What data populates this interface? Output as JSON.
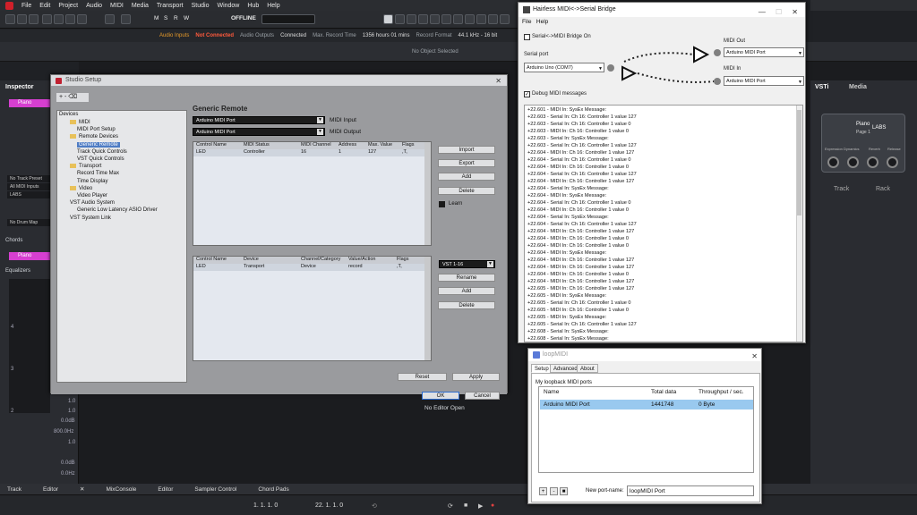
{
  "menubar": {
    "items": [
      "File",
      "Edit",
      "Project",
      "Audio",
      "MIDI",
      "Media",
      "Transport",
      "Studio",
      "Window",
      "Hub",
      "Help"
    ]
  },
  "toolbar": {
    "offline_label": "OFFLINE",
    "msrw": [
      "M",
      "S",
      "R",
      "W"
    ]
  },
  "status": {
    "audio_inputs": "Audio Inputs",
    "not_connected": "Not Connected",
    "audio_outputs": "Audio Outputs",
    "connected": "Connected",
    "max_rec_label": "Max. Record Time",
    "max_rec_value": "1356 hours 01 mins",
    "rec_format_label": "Record Format",
    "rec_format_value": "44.1 kHz - 16 bit"
  },
  "infoline": {
    "no_object": "No Object Selected"
  },
  "inspector": {
    "tab": "Inspector",
    "track_name": "Piano",
    "routing": [
      "No Track Preset",
      "All MIDI Inputs",
      "LABS",
      "No Drum Map"
    ],
    "chords_label": "Chords",
    "chords_track": "Piano",
    "equalizers_label": "Equalizers",
    "meter_nums": [
      "4",
      "3",
      "2"
    ],
    "values": [
      "1.0",
      "1.0",
      "0.0dB",
      "800.0Hz",
      "1.0",
      "0.0dB",
      "0.0Hz"
    ]
  },
  "editor": {
    "no_editor": "No Editor Open"
  },
  "bottom_tabs": [
    "Track",
    "Editor",
    "MixConsole",
    "Editor",
    "Sampler Control",
    "Chord Pads"
  ],
  "transport": {
    "left_locator": "1. 1. 1. 0",
    "right_locator": "22. 1. 1. 0",
    "position": "0:00:00.000",
    "tempo": "4/4"
  },
  "rack": {
    "tabs": [
      "VSTi",
      "Media"
    ],
    "slot_name": "Piano",
    "slot_plugin": "LABS",
    "slot_page": "Page 1",
    "knob_labels": [
      "Expression",
      "Dynamics",
      "Reverb",
      "Release"
    ],
    "track_label": "Track",
    "rack_label": "Rack"
  },
  "studio_setup": {
    "title": "Studio Setup",
    "tree_toolbar": "+ - ⌫",
    "devices_label": "Devices",
    "tree": [
      {
        "label": "MIDI",
        "indent": 1,
        "folder": true
      },
      {
        "label": "MIDI Port Setup",
        "indent": 2,
        "folder": false
      },
      {
        "label": "Remote Devices",
        "indent": 1,
        "folder": true
      },
      {
        "label": "Generic Remote",
        "indent": 2,
        "folder": false,
        "selected": true
      },
      {
        "label": "Track Quick Controls",
        "indent": 2,
        "folder": false
      },
      {
        "label": "VST Quick Controls",
        "indent": 2,
        "folder": false
      },
      {
        "label": "Transport",
        "indent": 1,
        "folder": true
      },
      {
        "label": "Record Time Max",
        "indent": 2,
        "folder": false
      },
      {
        "label": "Time Display",
        "indent": 2,
        "folder": false
      },
      {
        "label": "Video",
        "indent": 1,
        "folder": true
      },
      {
        "label": "Video Player",
        "indent": 2,
        "folder": false
      },
      {
        "label": "VST Audio System",
        "indent": 1,
        "folder": false
      },
      {
        "label": "Generic Low Latency ASIO Driver",
        "indent": 2,
        "folder": false
      },
      {
        "label": "VST System Link",
        "indent": 1,
        "folder": false
      }
    ],
    "heading": "Generic Remote",
    "midi_input_value": "Arduino MIDI Port",
    "midi_input_label": "MIDI Input",
    "midi_output_value": "Arduino MIDI Port",
    "midi_output_label": "MIDI Output",
    "table1": {
      "headers": [
        "Control Name",
        "MIDI Status",
        "MIDI Channel",
        "Address",
        "Max. Value",
        "Flags"
      ],
      "row": [
        "LED",
        "Controller",
        "16",
        "1",
        "127",
        ",T,"
      ]
    },
    "table2": {
      "headers": [
        "Control Name",
        "Device",
        "Channel/Category",
        "Value/Action",
        "Flags"
      ],
      "row": [
        "LED",
        "Transport",
        "Device",
        "record",
        ",T,"
      ]
    },
    "buttons_top": [
      "Import",
      "Export",
      "Add",
      "Delete"
    ],
    "learn": "Learn",
    "vst_combo": "VST 1-16",
    "buttons_bottom": [
      "Rename",
      "Add",
      "Delete"
    ],
    "reset": "Reset",
    "apply": "Apply",
    "ok": "OK",
    "cancel": "Cancel"
  },
  "hairless": {
    "title": "Hairless MIDI<->Serial Bridge",
    "menu": [
      "File",
      "Help"
    ],
    "bridge_on": "Serial<->MIDI Bridge On",
    "serial_port_label": "Serial port",
    "serial_port_value": "Arduino Uno (COM7)",
    "midi_out_label": "MIDI Out",
    "midi_out_value": "Arduino MIDI Port",
    "midi_in_label": "MIDI In",
    "midi_in_value": "Arduino MIDI Port",
    "debug_label": "Debug MIDI messages",
    "log": [
      "+22.601 - MIDI In: SysEx Message:",
      "+22.603 - Serial In: Ch 16: Controller 1 value 127",
      "+22.603 - Serial In: Ch 16: Controller 1 value 0",
      "+22.603 - MIDI In: Ch 16: Controller 1 value 0",
      "+22.603 - Serial In: SysEx Message:",
      "+22.603 - Serial In: Ch 16: Controller 1 value 127",
      "+22.604 - MIDI In: Ch 16: Controller 1 value 127",
      "+22.604 - Serial In: Ch 16: Controller 1 value 0",
      "+22.604 - MIDI In: Ch 16: Controller 1 value 0",
      "+22.604 - Serial In: Ch 16: Controller 1 value 127",
      "+22.604 - MIDI In: Ch 16: Controller 1 value 127",
      "+22.604 - Serial In: SysEx Message:",
      "+22.604 - MIDI In: SysEx Message:",
      "+22.604 - Serial In: Ch 16: Controller 1 value 0",
      "+22.604 - MIDI In: Ch 16: Controller 1 value 0",
      "+22.604 - Serial In: SysEx Message:",
      "+22.604 - Serial In: Ch 16: Controller 1 value 127",
      "+22.604 - MIDI In: Ch 16: Controller 1 value 127",
      "+22.604 - MIDI In: Ch 16: Controller 1 value 0",
      "+22.604 - MIDI In: Ch 16: Controller 1 value 0",
      "+22.604 - MIDI In: SysEx Message:",
      "+22.604 - MIDI In: Ch 16: Controller 1 value 127",
      "+22.604 - MIDI In: Ch 16: Controller 1 value 127",
      "+22.604 - MIDI In: Ch 16: Controller 1 value 0",
      "+22.604 - MIDI In: Ch 16: Controller 1 value 127",
      "+22.605 - MIDI In: Ch 16: Controller 1 value 127",
      "+22.605 - MIDI In: SysEx Message:",
      "+22.605 - Serial In: Ch 16: Controller 1 value 0",
      "+22.605 - MIDI In: Ch 16: Controller 1 value 0",
      "+22.605 - MIDI In: SysEx Message:",
      "+22.605 - Serial In: Ch 16: Controller 1 value 127",
      "+22.608 - Serial In: SysEx Message:",
      "+22.608 - Serial In: SysEx Message:"
    ]
  },
  "loopmidi": {
    "title": "loopMIDI",
    "tabs": [
      "Setup",
      "Advanced",
      "About"
    ],
    "group_label": "My loopback MIDI ports",
    "headers": [
      "Name",
      "Total data",
      "Throughput / sec."
    ],
    "row": [
      "Arduino MIDI Port",
      "1441748",
      "0 Byte"
    ],
    "buttons": [
      "+",
      "-",
      "■"
    ],
    "new_port_label": "New port-name:",
    "new_port_value": "loopMIDI Port"
  }
}
